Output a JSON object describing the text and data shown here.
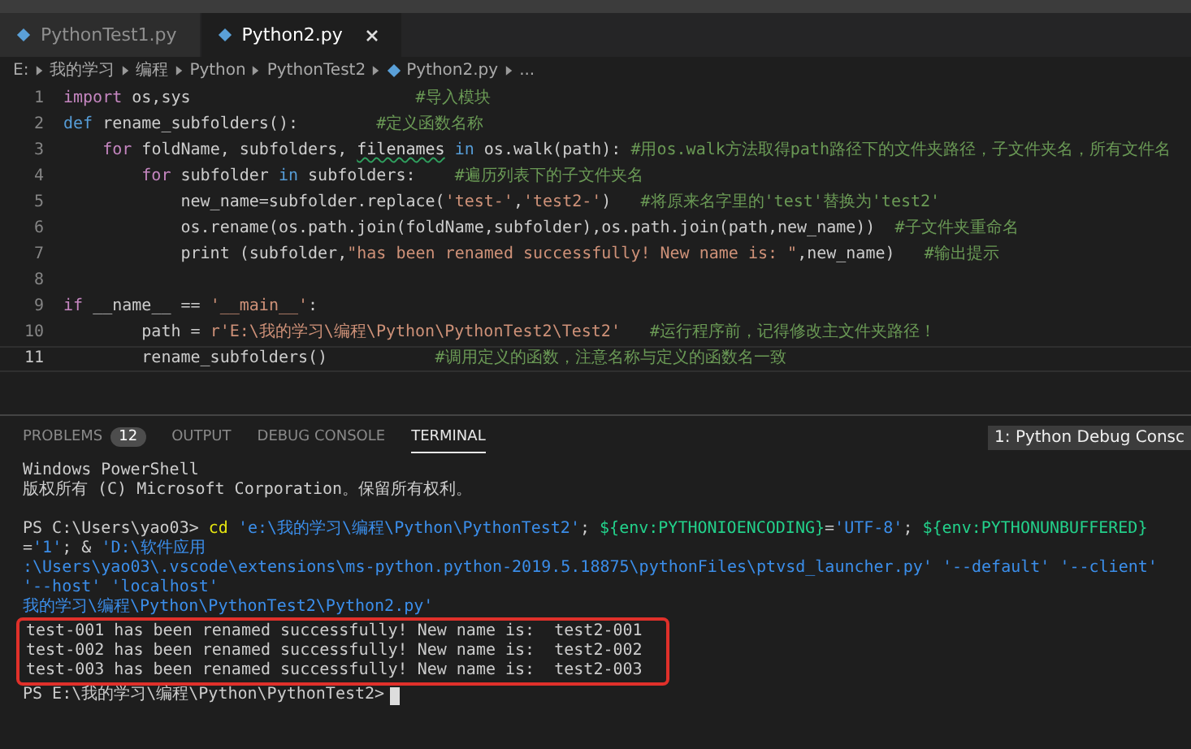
{
  "tabs": [
    {
      "label": "PythonTest1.py",
      "selected": false
    },
    {
      "label": "Python2.py",
      "selected": true
    }
  ],
  "breadcrumb": [
    "E:",
    "我的学习",
    "编程",
    "Python",
    "PythonTest2",
    "Python2.py",
    "..."
  ],
  "code_lines": [
    {
      "number": "1",
      "current": false,
      "tokens": [
        {
          "kind": "keyword",
          "text": "import"
        },
        {
          "kind": "plain",
          "text": " os,sys                       "
        },
        {
          "kind": "comment",
          "text": "#导入模块"
        }
      ]
    },
    {
      "number": "2",
      "current": false,
      "tokens": [
        {
          "kind": "keyword2",
          "text": "def"
        },
        {
          "kind": "plain",
          "text": " rename_subfolders():        "
        },
        {
          "kind": "comment",
          "text": "#定义函数名称"
        }
      ]
    },
    {
      "number": "3",
      "current": false,
      "tokens": [
        {
          "kind": "keyword",
          "text": "    for"
        },
        {
          "kind": "plain",
          "text": " foldName, subfolders, "
        },
        {
          "kind": "warning",
          "text": "filenames"
        },
        {
          "kind": "keyword2",
          "text": " in"
        },
        {
          "kind": "plain",
          "text": " os.walk(path): "
        },
        {
          "kind": "comment",
          "text": "#用os.walk方法取得path路径下的文件夹路径，子文件夹名，所有文件名"
        }
      ]
    },
    {
      "number": "4",
      "current": false,
      "tokens": [
        {
          "kind": "keyword",
          "text": "        for"
        },
        {
          "kind": "plain",
          "text": " subfolder "
        },
        {
          "kind": "keyword2",
          "text": "in"
        },
        {
          "kind": "plain",
          "text": " subfolders:    "
        },
        {
          "kind": "comment",
          "text": "#遍历列表下的子文件夹名"
        }
      ]
    },
    {
      "number": "5",
      "current": false,
      "tokens": [
        {
          "kind": "plain",
          "text": "            new_name=subfolder.replace("
        },
        {
          "kind": "string",
          "text": "'test-'"
        },
        {
          "kind": "plain",
          "text": ","
        },
        {
          "kind": "string",
          "text": "'test2-'"
        },
        {
          "kind": "plain",
          "text": ")   "
        },
        {
          "kind": "comment",
          "text": "#将原来名字里的'test'替换为'test2'"
        }
      ]
    },
    {
      "number": "6",
      "current": false,
      "tokens": [
        {
          "kind": "plain",
          "text": "            os.rename(os.path.join(foldName,subfolder),os.path.join(path,new_name))  "
        },
        {
          "kind": "comment",
          "text": "#子文件夹重命名"
        }
      ]
    },
    {
      "number": "7",
      "current": false,
      "tokens": [
        {
          "kind": "plain",
          "text": "            print (subfolder,"
        },
        {
          "kind": "string",
          "text": "\"has been renamed successfully! New name is: \""
        },
        {
          "kind": "plain",
          "text": ",new_name)   "
        },
        {
          "kind": "comment",
          "text": "#输出提示"
        }
      ]
    },
    {
      "number": "8",
      "current": false
    },
    {
      "number": "9",
      "current": false,
      "tokens": [
        {
          "kind": "keyword",
          "text": "if"
        },
        {
          "kind": "plain",
          "text": " __name__ == "
        },
        {
          "kind": "string",
          "text": "'__main__'"
        },
        {
          "kind": "plain",
          "text": ":"
        }
      ]
    },
    {
      "number": "10",
      "current": false,
      "tokens": [
        {
          "kind": "plain",
          "text": "        path = "
        },
        {
          "kind": "string",
          "text": "r'E:\\我的学习\\编程\\Python\\PythonTest2\\Test2'"
        },
        {
          "kind": "comment",
          "text": "   #运行程序前，记得修改主文件夹路径！"
        }
      ]
    },
    {
      "number": "11",
      "current": true,
      "tokens": [
        {
          "kind": "plain",
          "text": "        rename_subfolders()           "
        },
        {
          "kind": "comment",
          "text": "#调用定义的函数，注意名称与定义的函数名一致"
        }
      ]
    }
  ],
  "panel_tabs": [
    {
      "label": "PROBLEMS",
      "badge": "12",
      "selected": false
    },
    {
      "label": "OUTPUT",
      "selected": false
    },
    {
      "label": "DEBUG CONSOLE",
      "selected": false
    },
    {
      "label": "TERMINAL",
      "selected": true
    }
  ],
  "terminal_selector": "1: Python Debug Consc",
  "terminal": {
    "banner": [
      "Windows PowerShell",
      "版权所有 (C) Microsoft Corporation。保留所有权利。"
    ],
    "lines": [
      {
        "segments": [
          {
            "kind": "plain",
            "text": "PS C:\\Users\\yao03> "
          },
          {
            "kind": "command",
            "text": "cd"
          },
          {
            "kind": "string",
            "text": " 'e:\\我的学习\\编程\\Python\\PythonTest2'"
          },
          {
            "kind": "plain",
            "text": "; "
          },
          {
            "kind": "variable",
            "text": "${env:PYTHONIOENCODING}"
          },
          {
            "kind": "plain",
            "text": "="
          },
          {
            "kind": "string",
            "text": "'UTF-8'"
          },
          {
            "kind": "plain",
            "text": "; "
          },
          {
            "kind": "variable",
            "text": "${env:PYTHONUNBUFFERED}"
          },
          {
            "kind": "plain",
            "text": "="
          },
          {
            "kind": "string",
            "text": "'1'"
          },
          {
            "kind": "plain",
            "text": "; & "
          },
          {
            "kind": "string",
            "text": "'D:\\软件应用"
          }
        ]
      },
      {
        "segments": [
          {
            "kind": "string",
            "text": ":\\Users\\yao03\\.vscode\\extensions\\ms-python.python-2019.5.18875\\pythonFiles\\ptvsd_launcher.py'"
          },
          {
            "kind": "string",
            "text": " '--default'"
          },
          {
            "kind": "string",
            "text": " '--client'"
          },
          {
            "kind": "string",
            "text": " '--host'"
          },
          {
            "kind": "string",
            "text": " 'localhost'"
          }
        ]
      },
      {
        "segments": [
          {
            "kind": "string",
            "text": "我的学习\\编程\\Python\\PythonTest2\\Python2.py'"
          }
        ]
      }
    ],
    "highlighted_lines": [
      "test-001 has been renamed successfully! New name is:  test2-001",
      "test-002 has been renamed successfully! New name is:  test2-002",
      "test-003 has been renamed successfully! New name is:  test2-003"
    ],
    "prompt": "PS E:\\我的学习\\编程\\Python\\PythonTest2>"
  }
}
